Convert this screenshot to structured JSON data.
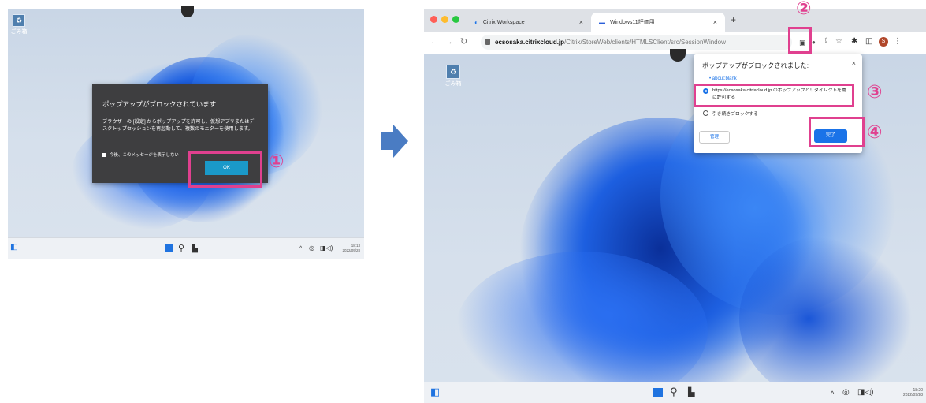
{
  "left_screen": {
    "desktop_icon_label": "ごみ箱",
    "dialog": {
      "title": "ポップアップがブロックされています",
      "body": "ブラウザーの [設定] からポップアップを許可し、仮想アプリまたはデスクトップセッションを再起動して、複数のモニターを使用します。",
      "checkbox_label": "今後、このメッセージを表示しない",
      "ok_label": "OK"
    },
    "taskbar": {
      "time": "18:13",
      "date": "2022/09/28"
    }
  },
  "step_numbers": [
    "①",
    "②",
    "③",
    "④"
  ],
  "browser": {
    "tabs": [
      {
        "title": "Citrix Workspace"
      },
      {
        "title": "Windows11評価用"
      }
    ],
    "new_tab_label": "+",
    "url_host": "ecsosaka.citrixcloud.jp",
    "url_path": "/Citrix/StoreWeb/clients/HTMLSClient/src/SessionWindow",
    "profile_initial": "S"
  },
  "popup_blocked_bubble": {
    "title": "ポップアップがブロックされました:",
    "blocked_item": "about:blank",
    "option_allow": "https://ecsosaka.citrixcloud.jp のポップアップとリダイレクトを常に許可する",
    "option_block": "引き続きブロックする",
    "manage_label": "管理",
    "done_label": "完了"
  },
  "right_screen": {
    "desktop_icon_label": "ごみ箱",
    "taskbar": {
      "time": "18:20",
      "date": "2022/09/28"
    }
  },
  "colors": {
    "highlight": "#e0408f",
    "accent": "#1a73e8",
    "arrow": "#4a7cc3"
  }
}
